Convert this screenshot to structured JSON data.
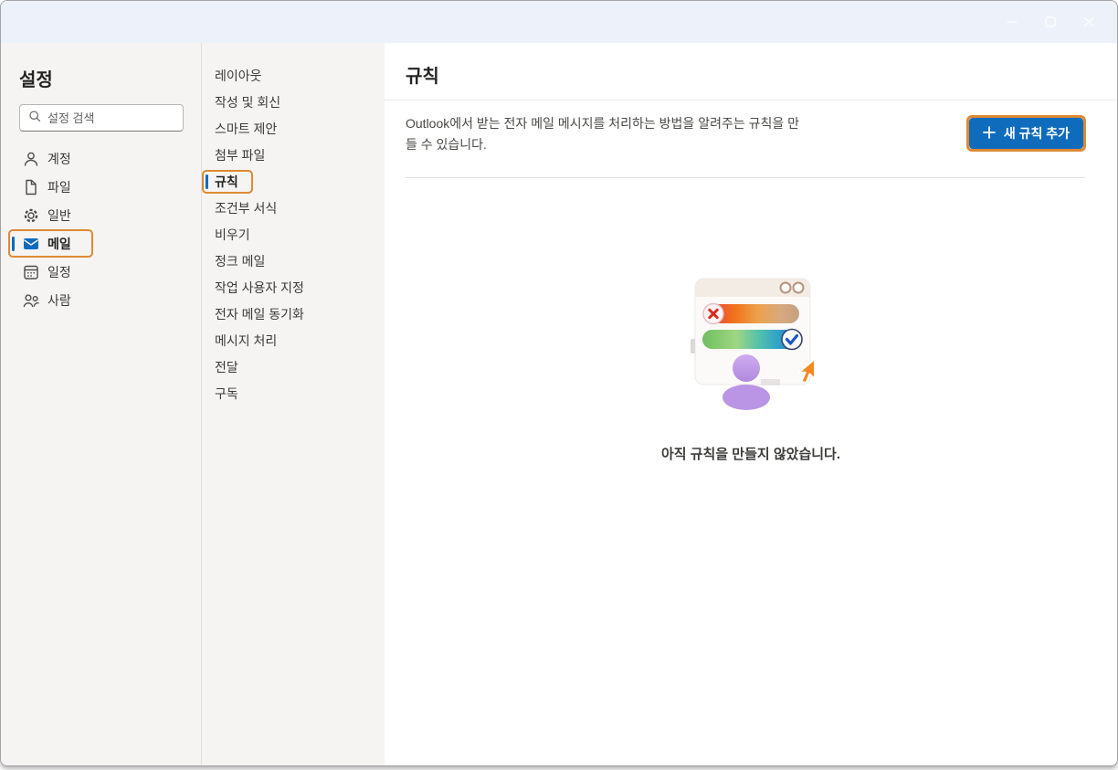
{
  "titlebar": {
    "controls": [
      {
        "icon": "minimize-icon"
      },
      {
        "icon": "maximize-icon"
      },
      {
        "icon": "close-icon"
      }
    ]
  },
  "sidebar": {
    "title": "설정",
    "search_placeholder": "설정 검색",
    "search_icon": "search-icon",
    "items": [
      {
        "label": "계정",
        "icon": "person-icon",
        "selected": false
      },
      {
        "label": "파일",
        "icon": "document-icon",
        "selected": false
      },
      {
        "label": "일반",
        "icon": "gear-icon",
        "selected": false
      },
      {
        "label": "메일",
        "icon": "mail-icon",
        "selected": true
      },
      {
        "label": "일정",
        "icon": "calendar-icon",
        "selected": false
      },
      {
        "label": "사람",
        "icon": "people-icon",
        "selected": false
      }
    ]
  },
  "submenu": {
    "items": [
      {
        "label": "레이아웃",
        "selected": false
      },
      {
        "label": "작성 및 회신",
        "selected": false
      },
      {
        "label": "스마트 제안",
        "selected": false
      },
      {
        "label": "첨부 파일",
        "selected": false
      },
      {
        "label": "규칙",
        "selected": true
      },
      {
        "label": "조건부 서식",
        "selected": false
      },
      {
        "label": "비우기",
        "selected": false
      },
      {
        "label": "정크 메일",
        "selected": false
      },
      {
        "label": "작업 사용자 지정",
        "selected": false
      },
      {
        "label": "전자 메일 동기화",
        "selected": false
      },
      {
        "label": "메시지 처리",
        "selected": false
      },
      {
        "label": "전달",
        "selected": false
      },
      {
        "label": "구독",
        "selected": false
      }
    ]
  },
  "main": {
    "title": "규칙",
    "description": "Outlook에서 받는 전자 메일 메시지를 처리하는 방법을 알려주는 규칙을 만들 수 있습니다.",
    "add_rule_button": {
      "label": "새 규칙 추가",
      "icon": "plus-icon"
    },
    "empty_state": {
      "message": "아직 규칙을 만들지 않았습니다.",
      "illustration": "rules-empty-illustration"
    }
  },
  "colors": {
    "accent_blue": "#0f6cbd",
    "highlight_orange": "#de8a33",
    "titlebar_bg": "#edf1f9",
    "sidebar_bg": "#f5f4f3"
  }
}
